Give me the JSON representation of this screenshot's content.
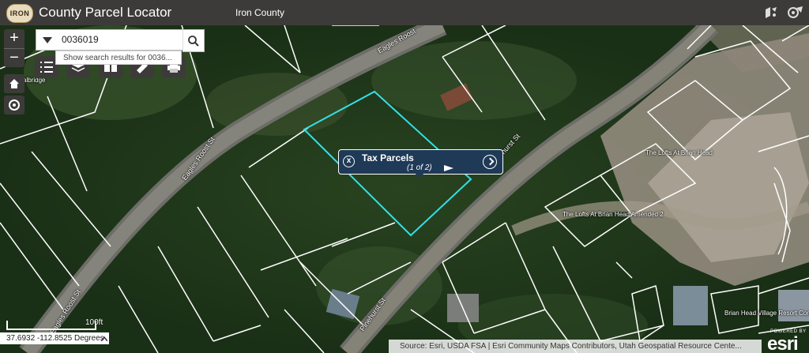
{
  "header": {
    "logo_text": "IRON",
    "title": "County Parcel Locator",
    "subtitle": "Iron County",
    "right_icons": [
      "share-icon",
      "about-icon"
    ]
  },
  "search": {
    "value": "0036019",
    "suggestion": "Show search results for 0036..."
  },
  "map_controls": {
    "zoom_in": "+",
    "zoom_out": "−"
  },
  "toolbar_icons": [
    "list-icon",
    "layers-icon",
    "basemap-icon",
    "measure-icon",
    "print-icon"
  ],
  "popup": {
    "title": "Tax Parcels",
    "count": "(1 of 2)"
  },
  "map_labels": {
    "roads": [
      "Eagles Roost",
      "Eagles Roost St",
      "Pinehurst St",
      "Pinehurst St",
      "Eagles Roost St"
    ],
    "subdivisions": [
      "The Lofts At Brian Head",
      "The Lofts At Brian Head Amended 2",
      "Brian Head Village Resort Con"
    ],
    "partial": "albridge"
  },
  "footer": {
    "coordinates": "37.6932 -112.8525 Degrees",
    "scale_label": "100ft",
    "attribution": "Source: Esri, USDA FSA | Esri Community Maps Contributors, Utah Geospatial Resource Cente...",
    "powered_by": "POWERED BY",
    "esri": "esri"
  },
  "colors": {
    "header_bg": "#3d3b3a",
    "popup_bg": "#1f3a57",
    "selected_parcel": "#33e0e6",
    "parcel_line": "#ffffff"
  }
}
